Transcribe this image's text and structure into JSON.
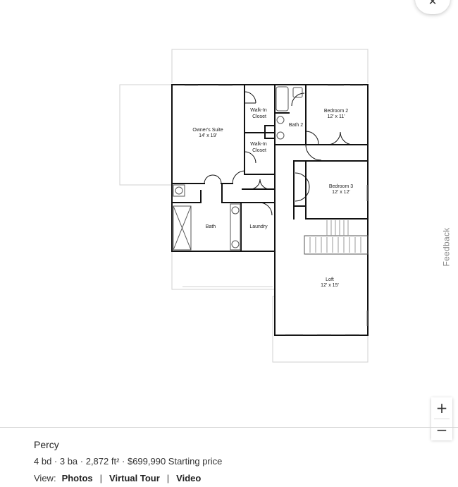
{
  "close_icon": "close-icon",
  "rooms": {
    "owners_suite": {
      "name": "Owner's Suite",
      "size": "14' x 19'"
    },
    "walk_in_closet_1": {
      "line1": "Walk-In",
      "line2": "Closet"
    },
    "walk_in_closet_2": {
      "line1": "Walk-In",
      "line2": "Closet"
    },
    "bath_2": {
      "name": "Bath 2"
    },
    "bedroom_2": {
      "name": "Bedroom 2",
      "size": "12' x 11'"
    },
    "bedroom_3": {
      "name": "Bedroom 3",
      "size": "12' x 12'"
    },
    "bath": {
      "name": "Bath"
    },
    "laundry": {
      "name": "Laundry"
    },
    "loft": {
      "name": "Loft",
      "size": "12' x 15'"
    }
  },
  "feedback_label": "Feedback",
  "zoom": {
    "in_label": "+",
    "out_label": "−"
  },
  "listing": {
    "name": "Percy",
    "details": "4 bd · 3 ba · 2,872 ft² · $699,990 Starting price",
    "view_label": "View:",
    "links": [
      "Photos",
      "Virtual Tour",
      "Video"
    ]
  }
}
